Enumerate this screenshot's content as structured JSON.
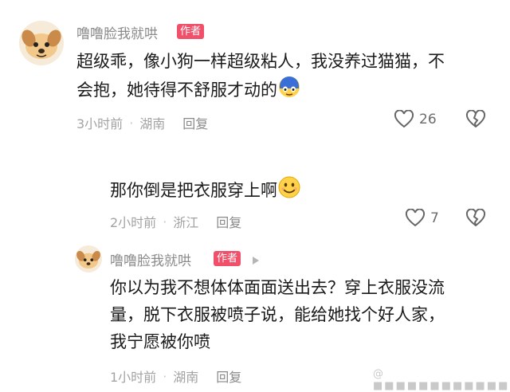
{
  "comments": [
    {
      "username": "噜噜脸我就哄",
      "badge": "作者",
      "text_line1": "超级乖，像小狗一样超级粘人，我没养过猫猫，不",
      "text_line2": "会抱，她待得不舒服才动的",
      "time": "3小时前",
      "location": "湖南",
      "reply_label": "回复",
      "likes": "26"
    },
    {
      "text": "那你倒是把衣服穿上啊",
      "time": "2小时前",
      "location": "浙江",
      "reply_label": "回复",
      "likes": "7"
    },
    {
      "username": "噜噜脸我就哄",
      "badge": "作者",
      "text_line1": "你以为我不想体体面面送出去？穿上衣服没流",
      "text_line2": "量，脱下衣服被喷子说，能给她找个好人家，",
      "text_line3": "我宁愿被你喷",
      "time": "1小时前",
      "location": "湖南",
      "reply_label": "回复"
    }
  ],
  "icons": {
    "like": "heart-outline-icon",
    "dislike": "broken-heart-icon",
    "reply_arrow": "play-arrow-icon"
  },
  "watermark": "@ ■■■■■■■■■■■■",
  "colors": {
    "badge": "#f1506a",
    "meta": "#a3a3a3",
    "text": "#1a1a1a"
  }
}
